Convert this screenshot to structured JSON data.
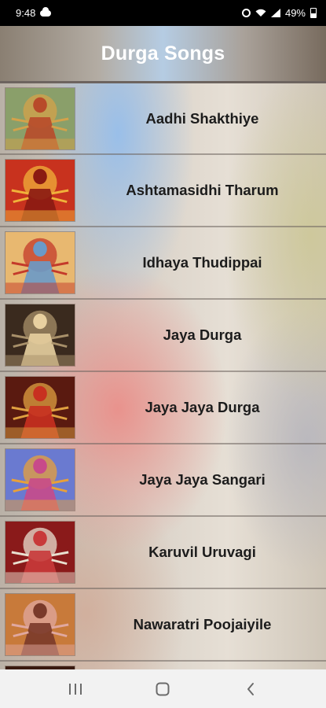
{
  "status_bar": {
    "time": "9:48",
    "battery": "49%",
    "icons": [
      "cloud-icon",
      "alarm-icon",
      "wifi-icon",
      "signal-icon",
      "battery-icon"
    ]
  },
  "app_bar": {
    "title": "Durga Songs"
  },
  "songs": [
    {
      "title": "Aadhi Shakthiye",
      "thumb_palette": [
        "#8a9f6a",
        "#d4a24a",
        "#b84a2a"
      ]
    },
    {
      "title": "Ashtamasidhi Tharum",
      "thumb_palette": [
        "#c8321e",
        "#f0b23a",
        "#8a1a12"
      ]
    },
    {
      "title": "Idhaya Thudippai",
      "thumb_palette": [
        "#e8b870",
        "#c43a2a",
        "#6a9ac8"
      ]
    },
    {
      "title": "Jaya Durga",
      "thumb_palette": [
        "#3a2a1e",
        "#a8906a",
        "#e8d0a0"
      ]
    },
    {
      "title": "Jaya Jaya Durga",
      "thumb_palette": [
        "#5a1a10",
        "#e0a040",
        "#c83020"
      ]
    },
    {
      "title": "Jaya Jaya Sangari",
      "thumb_palette": [
        "#6a7ad0",
        "#e8a03a",
        "#c84a8a"
      ]
    },
    {
      "title": "Karuvil Uruvagi",
      "thumb_palette": [
        "#8a1a1a",
        "#e8e0d0",
        "#c83a3a"
      ]
    },
    {
      "title": "Nawaratri Poojaiyile",
      "thumb_palette": [
        "#c87a3a",
        "#e0a8a0",
        "#7a3a2a"
      ]
    },
    {
      "title": "",
      "thumb_palette": [
        "#3a1a10",
        "#c86a2a",
        "#e8a040"
      ]
    }
  ],
  "nav_bar": {
    "recents": "recents-icon",
    "home": "home-icon",
    "back": "back-icon"
  }
}
